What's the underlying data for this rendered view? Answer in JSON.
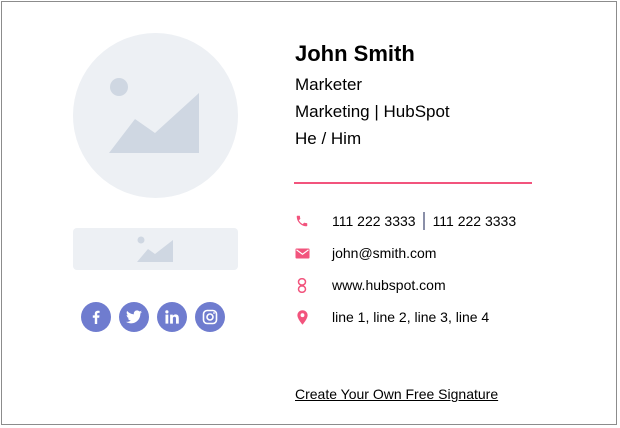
{
  "signature": {
    "name": "John Smith",
    "title": "Marketer",
    "department_company": "Marketing | HubSpot",
    "pronouns": "He / Him"
  },
  "contact": {
    "phone_1": "111 222 3333",
    "phone_2": "111 222 3333",
    "email": "john@smith.com",
    "website": "www.hubspot.com",
    "address": "line 1, line 2, line 3, line 4"
  },
  "icons": {
    "phone": "phone-icon",
    "email": "email-icon",
    "website": "link-icon",
    "address": "location-pin-icon",
    "profile_photo": "image-placeholder-icon",
    "company_logo": "image-placeholder-icon",
    "social": [
      "facebook-icon",
      "twitter-icon",
      "linkedin-icon",
      "instagram-icon"
    ]
  },
  "colors": {
    "accent": "#f2547d",
    "social": "#6f7ccf",
    "placeholder_bg": "#edf0f4",
    "placeholder_icon": "#cfd7e2"
  },
  "cta": {
    "label": "Create Your Own Free Signature"
  }
}
